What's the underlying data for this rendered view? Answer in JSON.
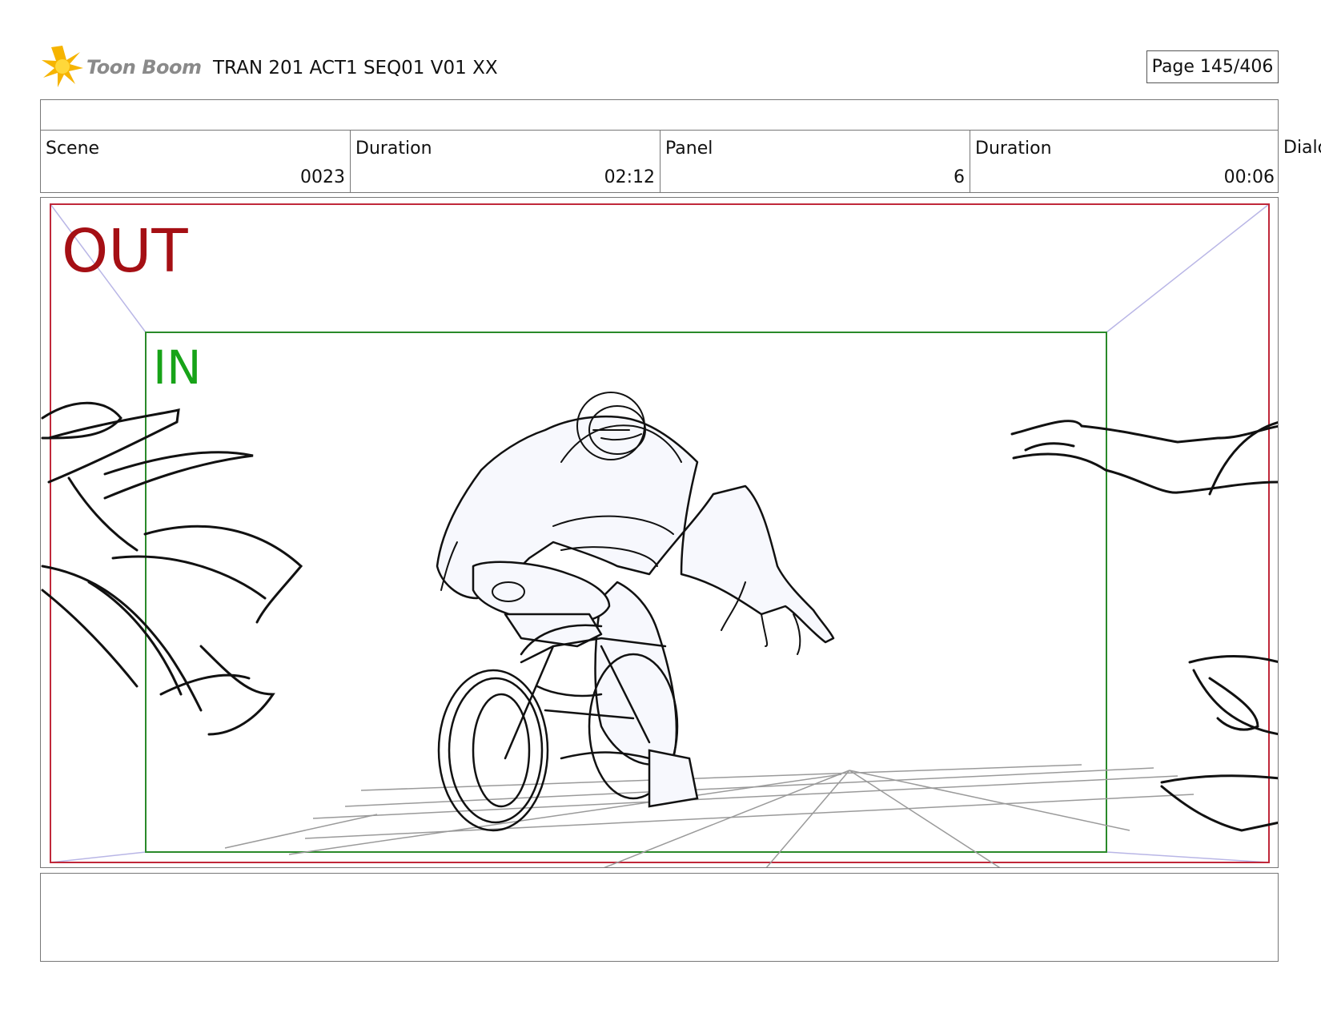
{
  "header": {
    "logo_text": "Toon Boom",
    "title": "TRAN 201 ACT1 SEQ01 V01 XX",
    "page": "Page 145/406"
  },
  "info": {
    "scene_label": "Scene",
    "scene_value": "0023",
    "scene_duration_label": "Duration",
    "scene_duration_value": "02:12",
    "panel_label": "Panel",
    "panel_value": "6",
    "panel_duration_label": "Duration",
    "panel_duration_value": "00:06",
    "dialog_label": "Dialo"
  },
  "panel": {
    "out_label": "OUT",
    "in_label": "IN"
  },
  "colors": {
    "out_frame": "#c0283a",
    "in_frame": "#2a8a2a",
    "out_text": "#a50f14",
    "in_text": "#17a318",
    "perspective": "#b9b6e6"
  }
}
